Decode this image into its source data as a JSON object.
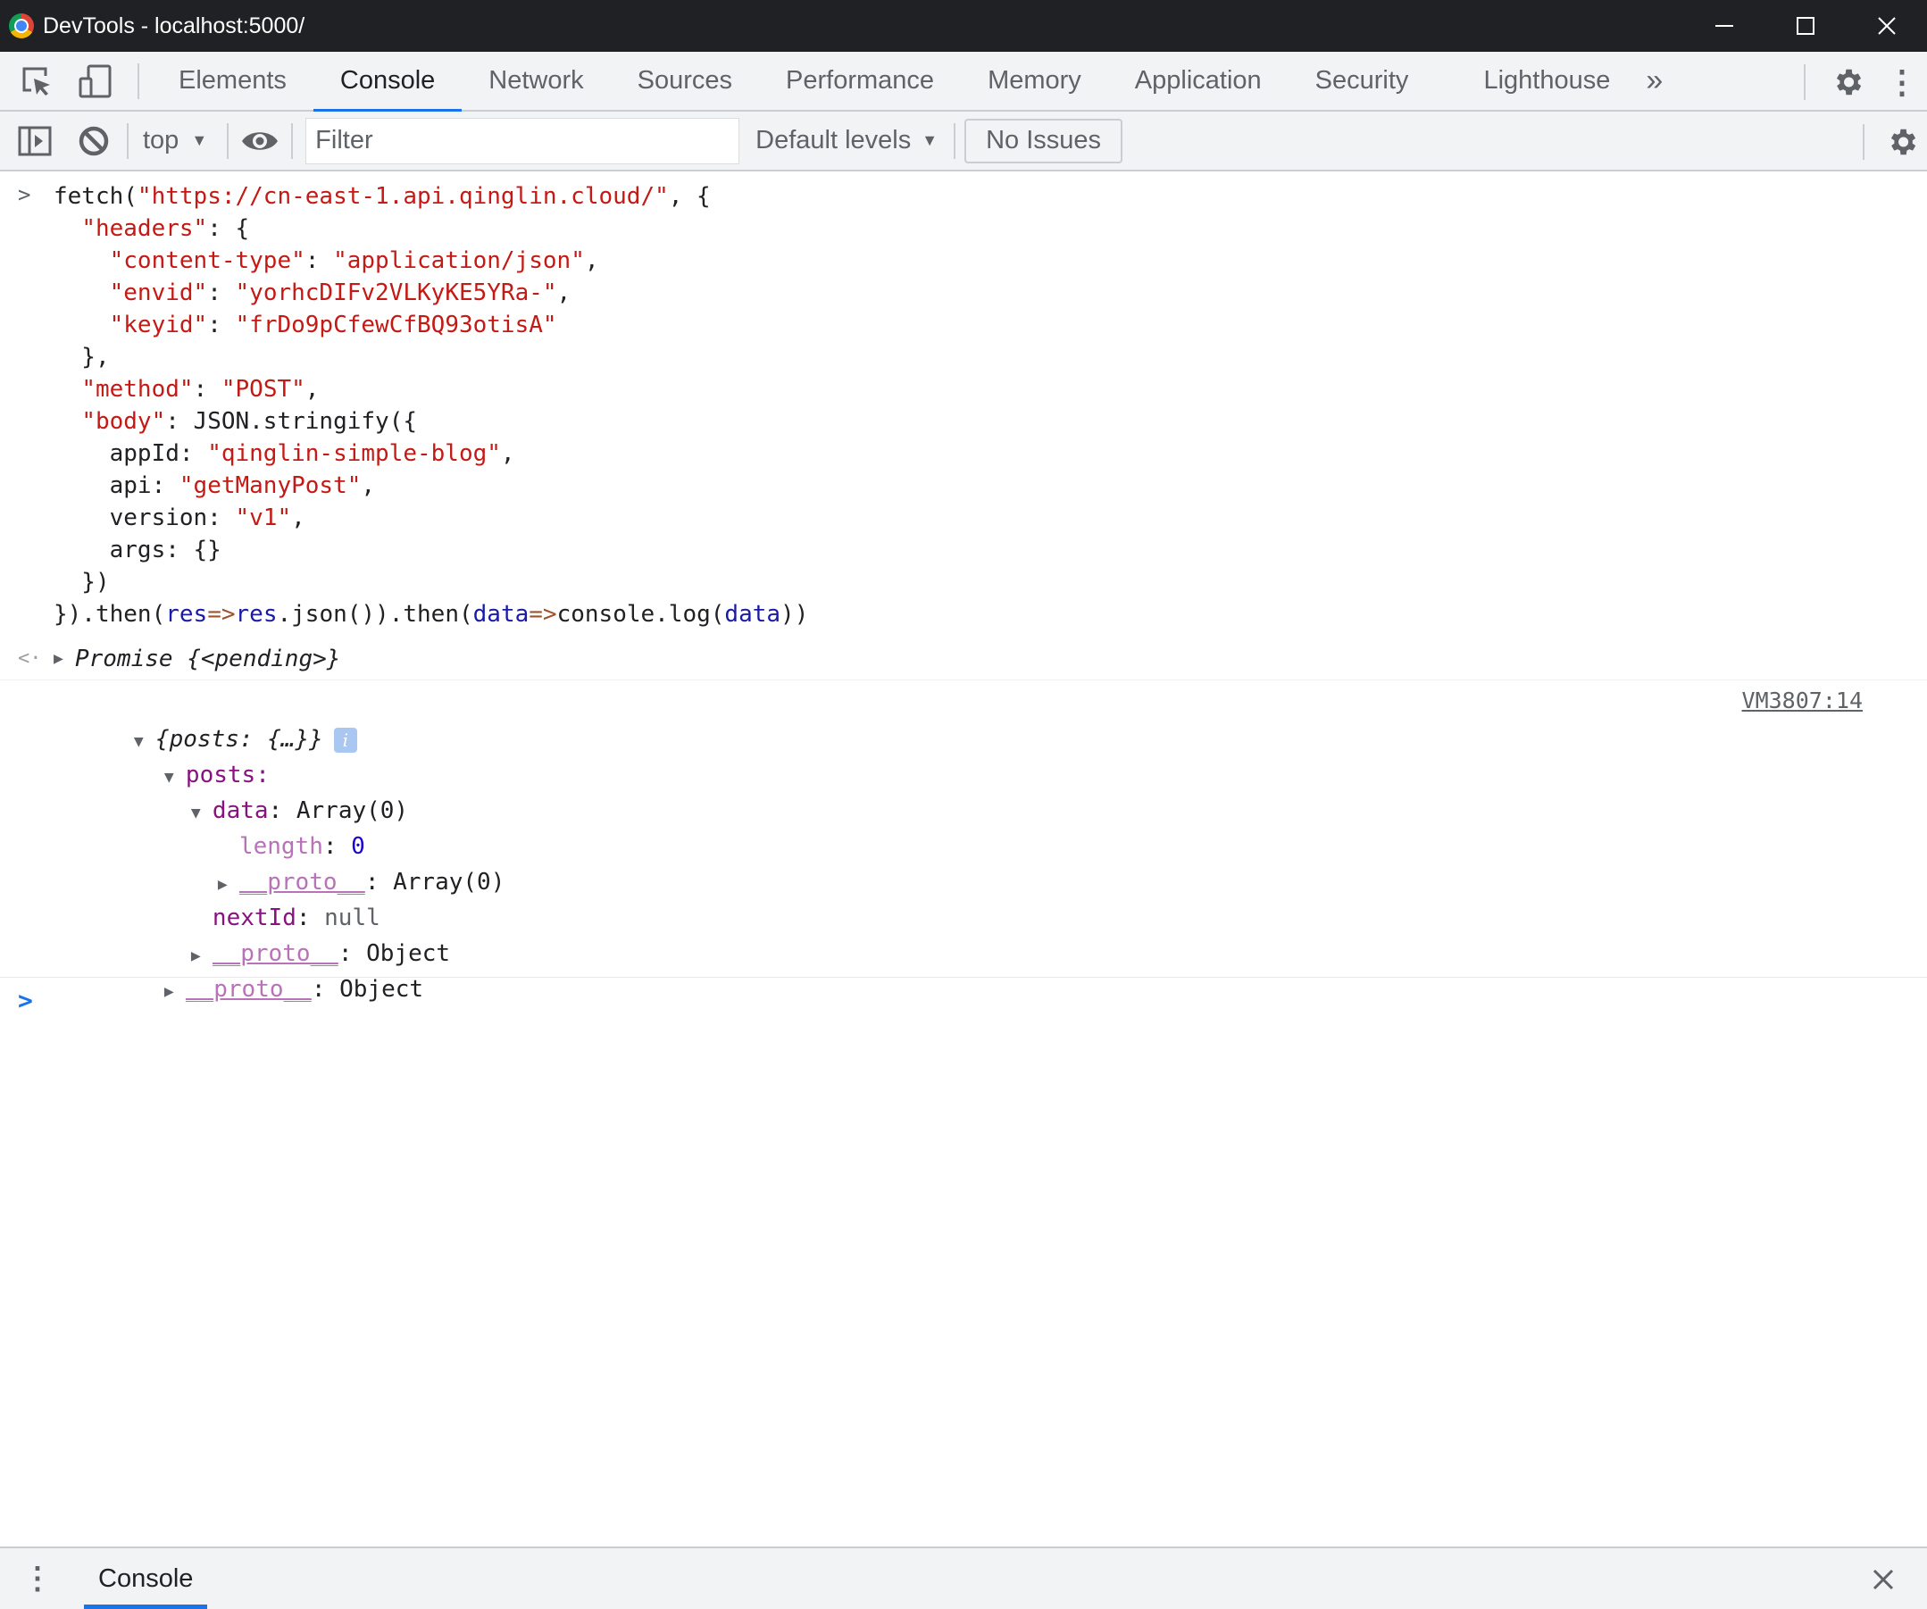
{
  "window": {
    "title": "DevTools - localhost:5000/",
    "controls": {
      "minimize": "—",
      "maximize": "☐",
      "close": "✕"
    }
  },
  "tabs": [
    {
      "label": "Elements",
      "active": false
    },
    {
      "label": "Console",
      "active": true
    },
    {
      "label": "Network",
      "active": false
    },
    {
      "label": "Sources",
      "active": false
    },
    {
      "label": "Performance",
      "active": false
    },
    {
      "label": "Memory",
      "active": false
    },
    {
      "label": "Application",
      "active": false
    },
    {
      "label": "Security",
      "active": false
    },
    {
      "label": "Lighthouse",
      "active": false
    }
  ],
  "tabbar": {
    "more": "»",
    "kebab": "⋮"
  },
  "toolbar": {
    "context": "top",
    "filter_placeholder": "Filter",
    "levels": "Default levels",
    "issues": "No Issues",
    "caret": "▼"
  },
  "console": {
    "input_prompt": ">",
    "input_lines": [
      [
        {
          "t": "fetch(",
          "c": ""
        },
        {
          "t": "\"https://cn-east-1.api.qinglin.cloud/\"",
          "c": "s"
        },
        {
          "t": ", {",
          "c": ""
        }
      ],
      [
        {
          "t": "  ",
          "c": ""
        },
        {
          "t": "\"headers\"",
          "c": "k"
        },
        {
          "t": ": {",
          "c": ""
        }
      ],
      [
        {
          "t": "    ",
          "c": ""
        },
        {
          "t": "\"content-type\"",
          "c": "k"
        },
        {
          "t": ": ",
          "c": ""
        },
        {
          "t": "\"application/json\"",
          "c": "s"
        },
        {
          "t": ",",
          "c": ""
        }
      ],
      [
        {
          "t": "    ",
          "c": ""
        },
        {
          "t": "\"envid\"",
          "c": "k"
        },
        {
          "t": ": ",
          "c": ""
        },
        {
          "t": "\"yorhcDIFv2VLKyKE5YRa-\"",
          "c": "s"
        },
        {
          "t": ",",
          "c": ""
        }
      ],
      [
        {
          "t": "    ",
          "c": ""
        },
        {
          "t": "\"keyid\"",
          "c": "k"
        },
        {
          "t": ": ",
          "c": ""
        },
        {
          "t": "\"frDo9pCfewCfBQ93otisA\"",
          "c": "s"
        }
      ],
      [
        {
          "t": "  },",
          "c": ""
        }
      ],
      [
        {
          "t": "  ",
          "c": ""
        },
        {
          "t": "\"method\"",
          "c": "k"
        },
        {
          "t": ": ",
          "c": ""
        },
        {
          "t": "\"POST\"",
          "c": "s"
        },
        {
          "t": ",",
          "c": ""
        }
      ],
      [
        {
          "t": "  ",
          "c": ""
        },
        {
          "t": "\"body\"",
          "c": "k"
        },
        {
          "t": ": JSON.stringify({",
          "c": ""
        }
      ],
      [
        {
          "t": "    appId: ",
          "c": ""
        },
        {
          "t": "\"qinglin-simple-blog\"",
          "c": "s"
        },
        {
          "t": ",",
          "c": ""
        }
      ],
      [
        {
          "t": "    api: ",
          "c": ""
        },
        {
          "t": "\"getManyPost\"",
          "c": "s"
        },
        {
          "t": ",",
          "c": ""
        }
      ],
      [
        {
          "t": "    version: ",
          "c": ""
        },
        {
          "t": "\"v1\"",
          "c": "s"
        },
        {
          "t": ",",
          "c": ""
        }
      ],
      [
        {
          "t": "    args: {}",
          "c": ""
        }
      ],
      [
        {
          "t": "  })",
          "c": ""
        }
      ],
      [
        {
          "t": "}).then(",
          "c": ""
        },
        {
          "t": "res",
          "c": "v"
        },
        {
          "t": "=>",
          "c": "arrow"
        },
        {
          "t": "res",
          "c": "v"
        },
        {
          "t": ".json()).then(",
          "c": ""
        },
        {
          "t": "data",
          "c": "v"
        },
        {
          "t": "=>",
          "c": "arrow"
        },
        {
          "t": "console.log(",
          "c": ""
        },
        {
          "t": "data",
          "c": "v"
        },
        {
          "t": "))",
          "c": ""
        }
      ]
    ],
    "result_arrow": "<·",
    "result": "Promise {<pending>}",
    "log": {
      "summary": "{posts: {…}}",
      "info_badge": "i",
      "source": "VM3807:14",
      "posts_key": "posts:",
      "data_key": "data",
      "data_value": "Array(0)",
      "length_key": "length",
      "length_value": "0",
      "proto_key": "__proto__",
      "array_proto_value": "Array(0)",
      "nextId_key": "nextId",
      "nextId_value": "null",
      "object_proto_value": "Object"
    },
    "new_prompt": ">"
  },
  "drawer": {
    "menu": "⋮",
    "tab": "Console",
    "close": "✕"
  }
}
